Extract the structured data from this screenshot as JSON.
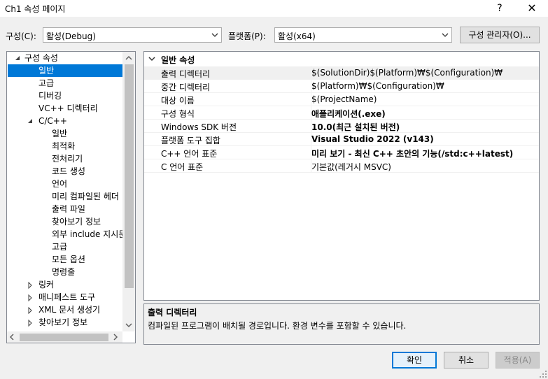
{
  "window": {
    "title": "Ch1 속성 페이지",
    "help": "?",
    "close": "✕"
  },
  "config": {
    "config_label": "구성(C):",
    "config_value": "활성(Debug)",
    "platform_label": "플랫폼(P):",
    "platform_value": "활성(x64)",
    "manager_button": "구성 관리자(O)..."
  },
  "tree": {
    "root": "구성 속성",
    "items": [
      "일반",
      "고급",
      "디버깅",
      "VC++ 디렉터리",
      "C/C++",
      "일반",
      "최적화",
      "전처리기",
      "코드 생성",
      "언어",
      "미리 컴파일된 헤더",
      "출력 파일",
      "찾아보기 정보",
      "외부 include 지시문",
      "고급",
      "모든 옵션",
      "명령줄",
      "링커",
      "매니페스트 도구",
      "XML 문서 생성기",
      "찾아보기 정보"
    ]
  },
  "grid": {
    "category": "일반 속성",
    "rows": [
      {
        "name": "출력 디렉터리",
        "value": "$(SolutionDir)$(Platform)₩$(Configuration)₩"
      },
      {
        "name": "중간 디렉터리",
        "value": "$(Platform)₩$(Configuration)₩"
      },
      {
        "name": "대상 이름",
        "value": "$(ProjectName)"
      },
      {
        "name": "구성 형식",
        "value": "애플리케이션(.exe)"
      },
      {
        "name": "Windows SDK 버전",
        "value": "10.0(최근 설치된 버전)"
      },
      {
        "name": "플랫폼 도구 집합",
        "value": "Visual Studio 2022 (v143)"
      },
      {
        "name": "C++ 언어 표준",
        "value": "미리 보기 - 최신 C++ 초안의 기능(/std:c++latest)"
      },
      {
        "name": "C 언어 표준",
        "value": "기본값(레거시 MSVC)"
      }
    ]
  },
  "description": {
    "title": "출력 디렉터리",
    "text": "컴파일된 프로그램이 배치될 경로입니다. 환경 변수를 포함할 수 있습니다."
  },
  "buttons": {
    "ok": "확인",
    "cancel": "취소",
    "apply": "적용(A)"
  },
  "colors": {
    "accent": "#0078d7",
    "background": "#f0f0f0"
  }
}
